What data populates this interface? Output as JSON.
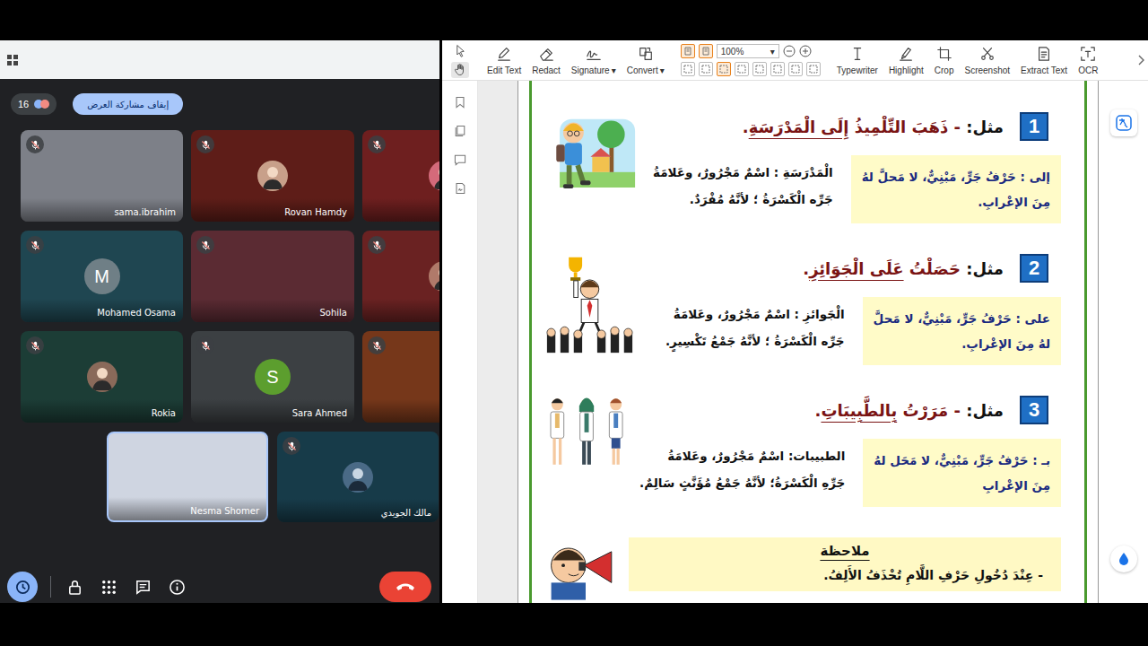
{
  "meet": {
    "participant_count": "16",
    "stop_presenting_button": "إيقاف مشاركة العرض",
    "grid_tiles": [
      {
        "name": "sama.ibrahim",
        "kind": "video",
        "muted": true,
        "speaking": false,
        "color": "#7d8088"
      },
      {
        "name": "Rovan Hamdy",
        "kind": "avatar",
        "muted": true,
        "speaking": false,
        "color": "#5e1d18",
        "avatar_color": "#c8a08a"
      },
      {
        "name": "",
        "kind": "avatar",
        "muted": true,
        "speaking": false,
        "color": "#6e1f1f",
        "avatar_color": "#d46a7a"
      },
      {
        "name": "Mohamed Osama",
        "kind": "letter",
        "initial": "M",
        "muted": true,
        "speaking": false,
        "color": "#1f4651",
        "avatar_color": "#6f7f86"
      },
      {
        "name": "Sohila",
        "kind": "video",
        "muted": true,
        "speaking": false,
        "color": "#5b2b33"
      },
      {
        "name": "",
        "kind": "avatar",
        "muted": true,
        "speaking": false,
        "color": "#6a2222",
        "avatar_color": "#b07a6a"
      },
      {
        "name": "Rokia",
        "kind": "avatar",
        "muted": true,
        "speaking": false,
        "color": "#1c3d36",
        "avatar_color": "#8a6a5a"
      },
      {
        "name": "Sara Ahmed",
        "kind": "letter",
        "initial": "S",
        "muted": true,
        "speaking": false,
        "color": "#3c4043",
        "avatar_color": "#5c9e2e"
      },
      {
        "name": "",
        "kind": "blank",
        "muted": true,
        "speaking": false,
        "color": "#76371a"
      }
    ],
    "featured_tiles": [
      {
        "name": "Nesma Shomer",
        "kind": "video",
        "muted": false,
        "speaking": true,
        "color": "#cfd5e1"
      },
      {
        "name": "مالك الجويدي",
        "kind": "avatar",
        "muted": true,
        "speaking": false,
        "color": "#173b49",
        "avatar_color": "#4a6a86"
      }
    ]
  },
  "pdf_editor": {
    "mode_tools": [
      {
        "kind": "pointer",
        "selected": false
      },
      {
        "kind": "hand",
        "selected": true
      }
    ],
    "tools": [
      {
        "label": "Edit Text",
        "kind": "edit-text"
      },
      {
        "label": "Redact",
        "kind": "redact"
      },
      {
        "label": "Signature",
        "kind": "signature",
        "caret": "▾"
      },
      {
        "label": "Convert",
        "kind": "convert",
        "caret": "▾"
      }
    ],
    "view": {
      "top_buttons": [
        {
          "selected": true
        },
        {
          "selected": true
        }
      ],
      "zoom": "100%",
      "zoom_caret": "▾",
      "bottom_buttons": [
        {
          "selected": false
        },
        {
          "selected": false
        },
        {
          "selected": true
        },
        {
          "selected": false
        },
        {
          "selected": false
        },
        {
          "selected": false
        },
        {
          "selected": false
        },
        {
          "selected": false
        }
      ]
    },
    "tools_right": [
      {
        "label": "Typewriter",
        "kind": "typewriter"
      },
      {
        "label": "Highlight",
        "kind": "highlight"
      },
      {
        "label": "Crop",
        "kind": "crop"
      },
      {
        "label": "Screenshot",
        "kind": "screenshot"
      },
      {
        "label": "Extract Text",
        "kind": "extract-text"
      },
      {
        "label": "OCR",
        "kind": "ocr"
      }
    ],
    "document": {
      "examples": [
        {
          "number": "1",
          "label": "مثل:",
          "kind": "student",
          "parts": [
            {
              "text": "- ذَهَبَ التِّلْمِيذُ ",
              "marked": false
            },
            {
              "text": "إِلَى الْمَدْرَسَةِ",
              "marked": true
            },
            {
              "text": ".",
              "marked": false
            }
          ],
          "box_lines": [
            "إلى : حَرْفُ جَرٍّ، مَبْنِيٌّ، لا مَحلَّ لهُ",
            "مِنَ الإعْرابِ."
          ],
          "explanation_lines": [
            "الْمَدْرَسَةِ : اسْمٌ مَجْرُورٌ، وعَلامَةُ",
            "جَرِّه الْكَسْرَةُ ؛ لأنَّهُ مُفْرَدٌ."
          ]
        },
        {
          "number": "2",
          "label": "مثل:",
          "kind": "trophy",
          "parts": [
            {
              "text": "حَصَلْتُ ",
              "marked": false
            },
            {
              "text": "عَلَى الْجَوَائِزِ",
              "marked": true
            },
            {
              "text": ".",
              "marked": false
            }
          ],
          "box_lines": [
            "على : حَرْفُ جَرٍّ، مَبْنِيٌّ، لا مَحلَّ",
            "لهُ مِنَ الإعْرابِ."
          ],
          "explanation_lines": [
            "الْجَوائزِ : اسْمٌ مَجْرُورٌ، وعَلامَةُ",
            "جَرِّه الْكَسْرَةُ ؛ لأنَّهُ جَمْعُ تَكْسِيرٍ."
          ]
        },
        {
          "number": "3",
          "label": "مثل:",
          "kind": "doctors",
          "parts": [
            {
              "text": "- مَرَرْتُ ",
              "marked": false
            },
            {
              "text": "بِالطَّبِيبَاتِ",
              "marked": true
            },
            {
              "text": ".",
              "marked": false
            }
          ],
          "box_lines": [
            "بـ : حَرْفُ جَرٍّ، مَبْنِيٌّ، لا مَحَل لهُ",
            "مِنَ الإعْرابِ"
          ],
          "explanation_lines": [
            "الطبيبات: اسْمٌ مَجْرُورٌ، وعَلامَةُ",
            "جَرِّهِ الْكَسْرَةُ؛ لأنَّهُ جَمْعُ مُؤَنَّثٍ سَالِمٌ."
          ]
        }
      ],
      "note": {
        "title": "ملاحظة",
        "lines": [
          "- عِنْدَ دُخُولِ حَرْفِ اللَّامِ تُحْذَفُ الأَلِفُ."
        ]
      }
    }
  }
}
